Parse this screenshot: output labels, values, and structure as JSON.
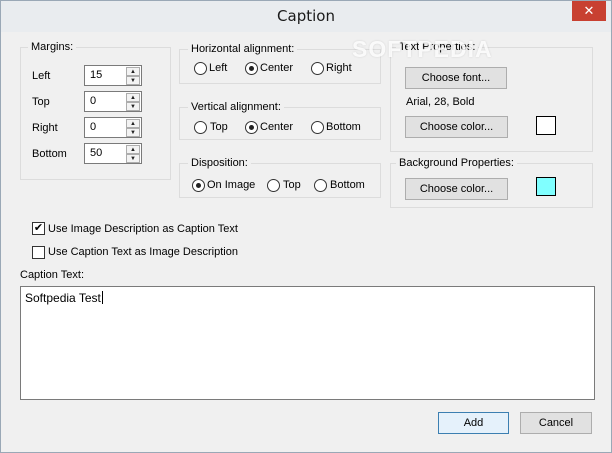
{
  "window": {
    "title": "Caption",
    "close_glyph": "✕"
  },
  "watermark": "SOFTPEDIA",
  "margins": {
    "title": "Margins:",
    "fields": [
      {
        "label": "Left",
        "value": "15"
      },
      {
        "label": "Top",
        "value": "0"
      },
      {
        "label": "Right",
        "value": "0"
      },
      {
        "label": "Bottom",
        "value": "50"
      }
    ]
  },
  "horizontal": {
    "title": "Horizontal alignment:",
    "options": [
      {
        "label": "Left",
        "selected": false
      },
      {
        "label": "Center",
        "selected": true
      },
      {
        "label": "Right",
        "selected": false
      }
    ]
  },
  "vertical": {
    "title": "Vertical alignment:",
    "options": [
      {
        "label": "Top",
        "selected": false
      },
      {
        "label": "Center",
        "selected": true
      },
      {
        "label": "Bottom",
        "selected": false
      }
    ]
  },
  "disposition": {
    "title": "Disposition:",
    "options": [
      {
        "label": "On Image",
        "selected": true
      },
      {
        "label": "Top",
        "selected": false
      },
      {
        "label": "Bottom",
        "selected": false
      }
    ]
  },
  "text_properties": {
    "title": "Text Properties:",
    "choose_font": "Choose font...",
    "font_desc": "Arial, 28, Bold",
    "choose_color": "Choose color...",
    "color": "#ffffff"
  },
  "background_properties": {
    "title": "Background Properties:",
    "choose_color": "Choose color...",
    "color": "#80ffff"
  },
  "checkboxes": [
    {
      "label": "Use Image Description as Caption Text",
      "checked": true
    },
    {
      "label": "Use Caption Text as Image Description",
      "checked": false
    }
  ],
  "caption": {
    "label": "Caption Text:",
    "value": "Softpedia Test"
  },
  "buttons": {
    "add": "Add",
    "cancel": "Cancel"
  }
}
